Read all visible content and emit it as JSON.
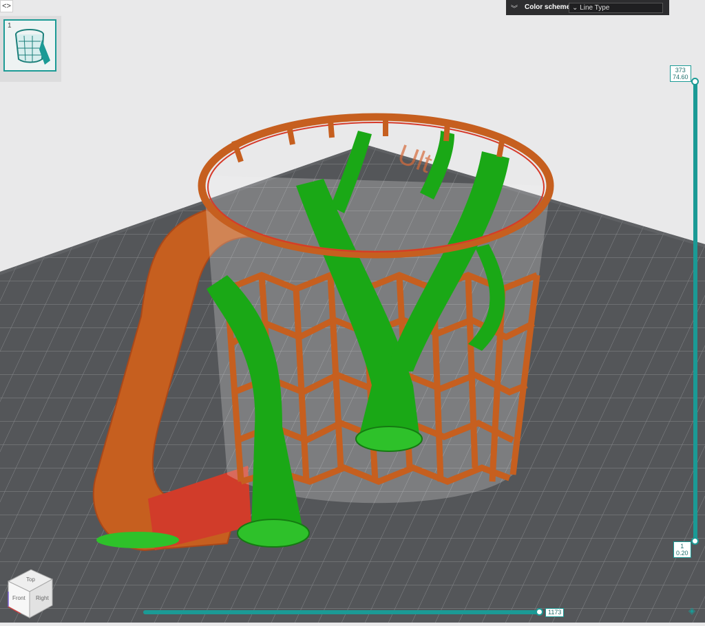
{
  "toolbar": {
    "collapse_icon": "<>"
  },
  "object_list": {
    "items": [
      {
        "index": "1",
        "thumb": "mug-thumbnail"
      }
    ]
  },
  "color_scheme": {
    "label": "Color scheme",
    "value": "Line Type"
  },
  "layer_slider": {
    "top": {
      "layer": "373",
      "height": "74.60"
    },
    "bottom": {
      "layer": "1",
      "height": "0.20"
    }
  },
  "move_slider": {
    "value": "1173"
  },
  "view_cube": {
    "top": "Top",
    "front": "Front",
    "right": "Right"
  },
  "colors": {
    "accent": "#1b9a95",
    "wall_outer": "#c9621d",
    "wall_inner": "#d63a2a",
    "support": "#19b517",
    "bed": "#545659"
  }
}
